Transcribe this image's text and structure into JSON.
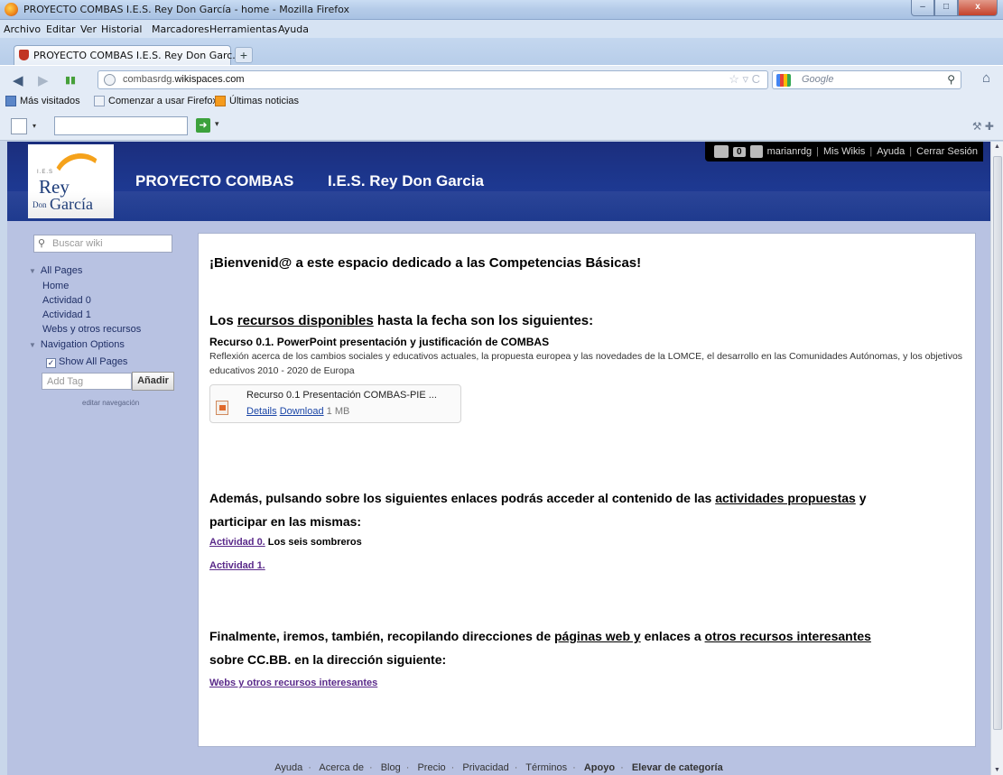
{
  "window": {
    "title": "PROYECTO COMBAS I.E.S. Rey Don García - home - Mozilla Firefox",
    "buttons": {
      "minimize": "–",
      "maximize": "□",
      "close": "x"
    }
  },
  "menu": [
    "Archivo",
    "Editar",
    "Ver",
    "Historial",
    "Marcadores",
    "Herramientas",
    "Ayuda"
  ],
  "tab": {
    "label": "PROYECTO COMBAS I.E.S. Rey Don Garc...",
    "new_tab": "+"
  },
  "nav": {
    "url_host_prefix": "combasrdg.",
    "url_domain": "wikispaces.com",
    "search_placeholder": "Google"
  },
  "bookmarks": [
    "Más visitados",
    "Comenzar a usar Firefox",
    "Últimas noticias"
  ],
  "site": {
    "title": "PROYECTO COMBAS",
    "school": "I.E.S. Rey Don Garcia",
    "logo": {
      "small": "I.E.S",
      "rey": "Rey",
      "don": "Don",
      "garcia": "García"
    }
  },
  "userbar": {
    "count": "0",
    "username": "marianrdg",
    "links": [
      "Mis Wikis",
      "Ayuda",
      "Cerrar Sesión"
    ]
  },
  "sidebar": {
    "search_placeholder": "Buscar wiki",
    "all_pages": "All Pages",
    "pages": [
      "Home",
      "Actividad 0",
      "Actividad 1",
      "Webs y otros recursos"
    ],
    "nav_options": "Navigation Options",
    "show_all_pages": "Show All Pages",
    "add_tag_placeholder": "Add Tag",
    "add_button": "Añadir",
    "edit_nav": "editar navegación"
  },
  "content": {
    "welcome": "¡Bienvenid@ a este espacio dedicado a las Competencias Básicas!",
    "resources_pre": "Los ",
    "resources_link": "recursos disponibles",
    "resources_post": " hasta la fecha son los siguientes:",
    "resource_title": "Recurso 0.1. PowerPoint presentación y justificación de COMBAS",
    "resource_desc": "Reflexión acerca de los cambios sociales y educativos actuales, la propuesta europea y las novedades de la LOMCE, el desarrollo en las Comunidades Autónomas, y los objetivos educativos 2010 - 2020 de Europa",
    "file": {
      "name": "Recurso 0.1 Presentación COMBAS-PIE ...",
      "details": "Details",
      "download": "Download",
      "size": "1 MB"
    },
    "activities_line1_pre": "Además, pulsando sobre los siguientes enlaces podrás acceder al contenido de las ",
    "activities_link": "actividades propuestas",
    "activities_line1_post": " y",
    "activities_line2": "participar en las mismas:",
    "act0_link": "Actividad 0.",
    "act0_text": " Los seis sombreros",
    "act1_link": "Actividad 1.",
    "final_pre": "Finalmente, iremos, también, recopilando direcciones de ",
    "final_link1": "páginas web y",
    "final_mid": " enlaces a ",
    "final_link2": "otros recursos interesantes",
    "final_line2": "sobre CC.BB. en la dirección siguiente:",
    "webs_link": "Webs y otros recursos interesantes"
  },
  "footer": [
    "Ayuda",
    "Acerca de",
    "Blog",
    "Precio",
    "Privacidad",
    "Términos",
    "Apoyo",
    "Elevar de categoría"
  ]
}
